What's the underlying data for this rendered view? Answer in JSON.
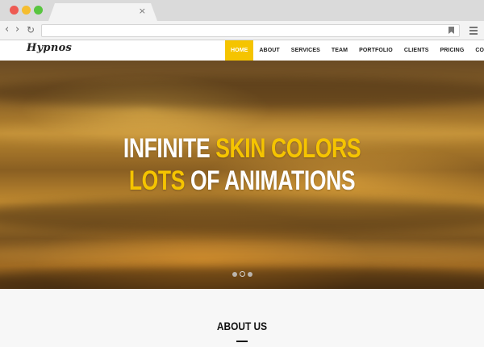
{
  "browser": {
    "tab_close_glyph": "×",
    "back_glyph": "‹",
    "forward_glyph": "›",
    "reload_glyph": "↻",
    "address_value": ""
  },
  "site": {
    "logo": "Hypnos",
    "menu": [
      {
        "label": "HOME",
        "active": true
      },
      {
        "label": "ABOUT",
        "active": false
      },
      {
        "label": "SERVICES",
        "active": false
      },
      {
        "label": "TEAM",
        "active": false
      },
      {
        "label": "PORTFOLIO",
        "active": false
      },
      {
        "label": "CLIENTS",
        "active": false
      },
      {
        "label": "PRICING",
        "active": false
      },
      {
        "label": "CONTACT",
        "active": false
      }
    ]
  },
  "hero": {
    "line1_white": "INFINITE",
    "line1_yellow": "SKIN COLORS",
    "line2_yellow": "LOTS",
    "line2_white": "OF ANIMATIONS",
    "slides": 3,
    "active_slide": 2
  },
  "about": {
    "title": "ABOUT US"
  },
  "colors": {
    "accent": "#f5c400",
    "text_dark": "#222222"
  }
}
